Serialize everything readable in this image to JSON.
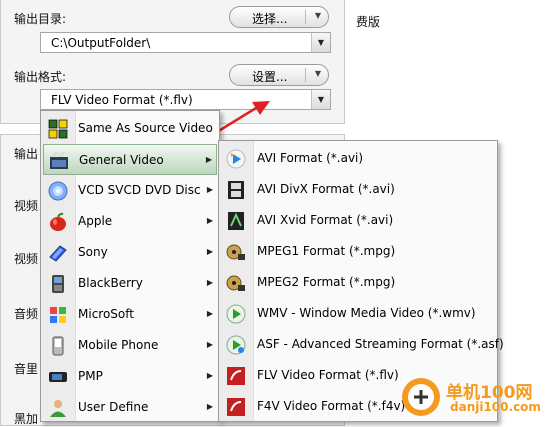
{
  "settings": {
    "output_dir_label": "输出目录:",
    "output_dir_value": "C:\\OutputFolder\\",
    "browse_button": "选择...",
    "output_format_label": "输出格式:",
    "output_format_value": "FLV Video Format (*.flv)",
    "settings_button": "设置...",
    "right_partial_text": "费版",
    "lower_labels": [
      "输出",
      "视频",
      "视频",
      "音频",
      "音里",
      "黑加"
    ]
  },
  "menu": {
    "items": [
      {
        "label": "Same As Source Video",
        "icon": "grid-icon",
        "submenu": false
      },
      {
        "label": "General Video",
        "icon": "film-icon",
        "submenu": true,
        "selected": true
      },
      {
        "label": "VCD SVCD DVD Disc",
        "icon": "disc-icon",
        "submenu": true
      },
      {
        "label": "Apple",
        "icon": "apple-icon",
        "submenu": true
      },
      {
        "label": "Sony",
        "icon": "sony-icon",
        "submenu": true
      },
      {
        "label": "BlackBerry",
        "icon": "blackberry-icon",
        "submenu": true
      },
      {
        "label": "MicroSoft",
        "icon": "microsoft-icon",
        "submenu": true
      },
      {
        "label": "Mobile Phone",
        "icon": "phone-icon",
        "submenu": true
      },
      {
        "label": "PMP",
        "icon": "pmp-icon",
        "submenu": true
      },
      {
        "label": "User Define",
        "icon": "user-icon",
        "submenu": true
      }
    ]
  },
  "submenu": {
    "items": [
      {
        "label": "AVI Format (*.avi)",
        "icon": "play-icon"
      },
      {
        "label": "AVI DivX Format (*.avi)",
        "icon": "filmstrip-icon"
      },
      {
        "label": "AVI Xvid Format (*.avi)",
        "icon": "xvid-icon"
      },
      {
        "label": "MPEG1 Format (*.mpg)",
        "icon": "reel-icon"
      },
      {
        "label": "MPEG2 Format (*.mpg)",
        "icon": "reel-icon"
      },
      {
        "label": "WMV - Window Media Video (*.wmv)",
        "icon": "wmv-icon"
      },
      {
        "label": "ASF - Advanced Streaming Format (*.asf)",
        "icon": "asf-icon"
      },
      {
        "label": "FLV Video Format (*.flv)",
        "icon": "flv-icon"
      },
      {
        "label": "F4V Video Format (*.f4v)",
        "icon": "f4v-icon"
      }
    ]
  },
  "watermark": {
    "brand": "单机100网",
    "url": "danji100.com"
  },
  "colors": {
    "highlight": "#bcd6bc",
    "arrow": "#e02020",
    "watermark": "#f39a1f"
  }
}
